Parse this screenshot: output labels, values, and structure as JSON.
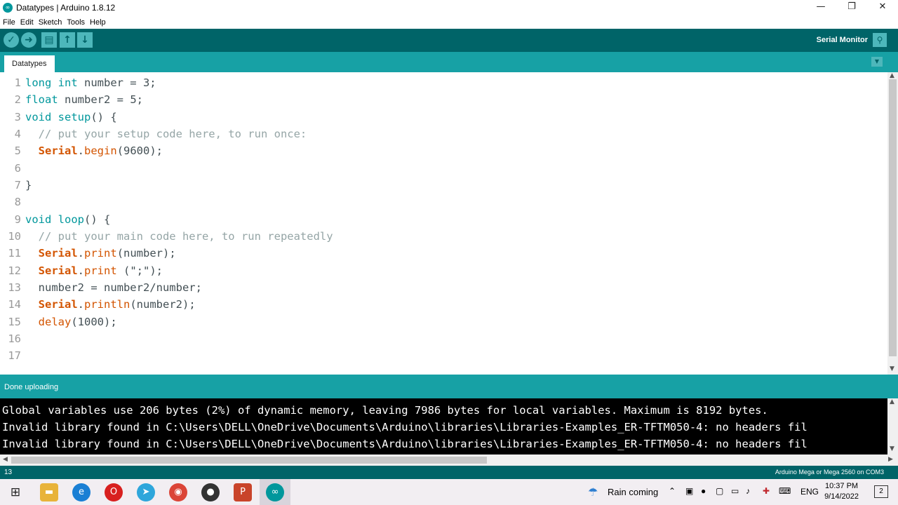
{
  "window": {
    "title": "Datatypes | Arduino 1.8.12",
    "minimize": "—",
    "restore": "❐",
    "close": "✕"
  },
  "menu": [
    "File",
    "Edit",
    "Sketch",
    "Tools",
    "Help"
  ],
  "toolbar": {
    "serial_monitor_label": "Serial Monitor"
  },
  "tabs": [
    {
      "label": "Datatypes"
    }
  ],
  "editor": {
    "lines": [
      {
        "n": "1"
      },
      {
        "n": "2"
      },
      {
        "n": "3"
      },
      {
        "n": "4"
      },
      {
        "n": "5"
      },
      {
        "n": "6"
      },
      {
        "n": "7"
      },
      {
        "n": "8"
      },
      {
        "n": "9"
      },
      {
        "n": "10"
      },
      {
        "n": "11"
      },
      {
        "n": "12"
      },
      {
        "n": "13"
      },
      {
        "n": "14"
      },
      {
        "n": "15"
      },
      {
        "n": "16"
      },
      {
        "n": "17"
      }
    ],
    "code": {
      "l1_kw": "long int",
      "l1_rest": " number = 3;",
      "l2_kw": "float",
      "l2_rest": " number2 = 5;",
      "l3_kw": "void",
      "l3_sp": " ",
      "l3_fn": "setup",
      "l3_rest": "() {",
      "l4": "  // put your setup code here, to run once:",
      "l5_ind": "  ",
      "l5_cls": "Serial",
      "l5_dot": ".",
      "l5_fn": "begin",
      "l5_rest": "(9600);",
      "l7": "}",
      "l9_kw": "void",
      "l9_sp": " ",
      "l9_fn": "loop",
      "l9_rest": "() {",
      "l10": "  // put your main code here, to run repeatedly",
      "l11_ind": "  ",
      "l11_cls": "Serial",
      "l11_dot": ".",
      "l11_fn": "print",
      "l11_rest": "(number);",
      "l12_ind": "  ",
      "l12_cls": "Serial",
      "l12_dot": ".",
      "l12_fn": "print",
      "l12_rest": " (\";\");",
      "l13": "  number2 = number2/number;",
      "l14_ind": "  ",
      "l14_cls": "Serial",
      "l14_dot": ".",
      "l14_fn": "println",
      "l14_rest": "(number2);",
      "l15_ind": "  ",
      "l15_fn": "delay",
      "l15_rest": "(1000);"
    }
  },
  "status": {
    "message": "Done uploading"
  },
  "console": {
    "lines": [
      "Global variables use 206 bytes (2%) of dynamic memory, leaving 7986 bytes for local variables. Maximum is 8192 bytes.",
      "Invalid library found in C:\\Users\\DELL\\OneDrive\\Documents\\Arduino\\libraries\\Libraries-Examples_ER-TFTM050-4: no headers fil",
      "Invalid library found in C:\\Users\\DELL\\OneDrive\\Documents\\Arduino\\libraries\\Libraries-Examples_ER-TFTM050-4: no headers fil"
    ]
  },
  "footer": {
    "line_number": "13",
    "board": "Arduino Mega or Mega 2560 on COM3"
  },
  "taskbar": {
    "weather": "Rain coming",
    "language": "ENG",
    "time": "10:37 PM",
    "date": "9/14/2022",
    "notifications": "2"
  },
  "colors": {
    "arduino_teal_dark": "#006468",
    "arduino_teal": "#17a1a5",
    "keyword": "#00979c",
    "function": "#d35400",
    "comment": "#95a5a6"
  }
}
